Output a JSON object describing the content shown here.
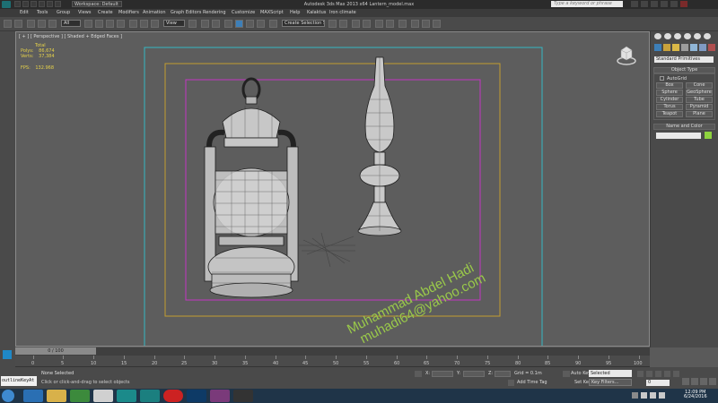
{
  "titlebar": {
    "workspace": "Workspace: Default",
    "title": "Autodesk 3ds Max  2013 x64     Lantern_model.max",
    "search_placeholder": "Type a keyword or phrase"
  },
  "menu": [
    "Edit",
    "Tools",
    "Group",
    "Views",
    "Create",
    "Modifiers",
    "Animation",
    "Graph Editors",
    "Rendering",
    "Customize",
    "MAXScript",
    "Help",
    "Kalaktus",
    "Iron climate"
  ],
  "toolbar": {
    "filter": "All",
    "view": "View",
    "named_selection": "Create Selection Se"
  },
  "viewport": {
    "label": "[ + ] [ Perspective ] [ Shaded + Edged Faces ]",
    "stats": {
      "header": "Total",
      "polys_label": "Polys:",
      "polys": "86,674",
      "verts_label": "Verts:",
      "verts": "37,384",
      "fps_label": "FPS:",
      "fps": "132.968"
    },
    "watermark_line1": "Muhammad Abdel Hadi",
    "watermark_line2": "muhadi64@yahoo.com"
  },
  "command_panel": {
    "category": "Standard Primitives",
    "object_type_title": "Object Type",
    "autogrid": "AutoGrid",
    "buttons": [
      "Box",
      "Cone",
      "Sphere",
      "GeoSphere",
      "Cylinder",
      "Tube",
      "Torus",
      "Pyramid",
      "Teapot",
      "Plane"
    ],
    "name_color_title": "Name and Color"
  },
  "timeline": {
    "slider": "0 / 100",
    "ticks": [
      "0",
      "5",
      "10",
      "15",
      "20",
      "25",
      "30",
      "35",
      "40",
      "45",
      "50",
      "55",
      "60",
      "65",
      "70",
      "75",
      "80",
      "85",
      "90",
      "95",
      "100"
    ]
  },
  "status": {
    "maxscript": "outlineKeyAt",
    "selection": "None Selected",
    "prompt": "Click or click-and-drag to select objects",
    "x_label": "X:",
    "y_label": "Y:",
    "z_label": "Z:",
    "grid": "Grid = 0.1m",
    "add_time_tag": "Add Time Tag",
    "auto_key": "Auto Key",
    "selected": "Selected",
    "set_key": "Set Key",
    "key_filters": "Key Filters...",
    "frame": "0"
  },
  "taskbar": {
    "time": "12:09 PM",
    "date": "6/24/2016"
  },
  "colors": {
    "watermark": "#9ac94a",
    "stats": "#e6d24a",
    "safe_outer": "#35b7c2",
    "safe_action": "#c29d2e",
    "safe_title": "#c335c4"
  }
}
